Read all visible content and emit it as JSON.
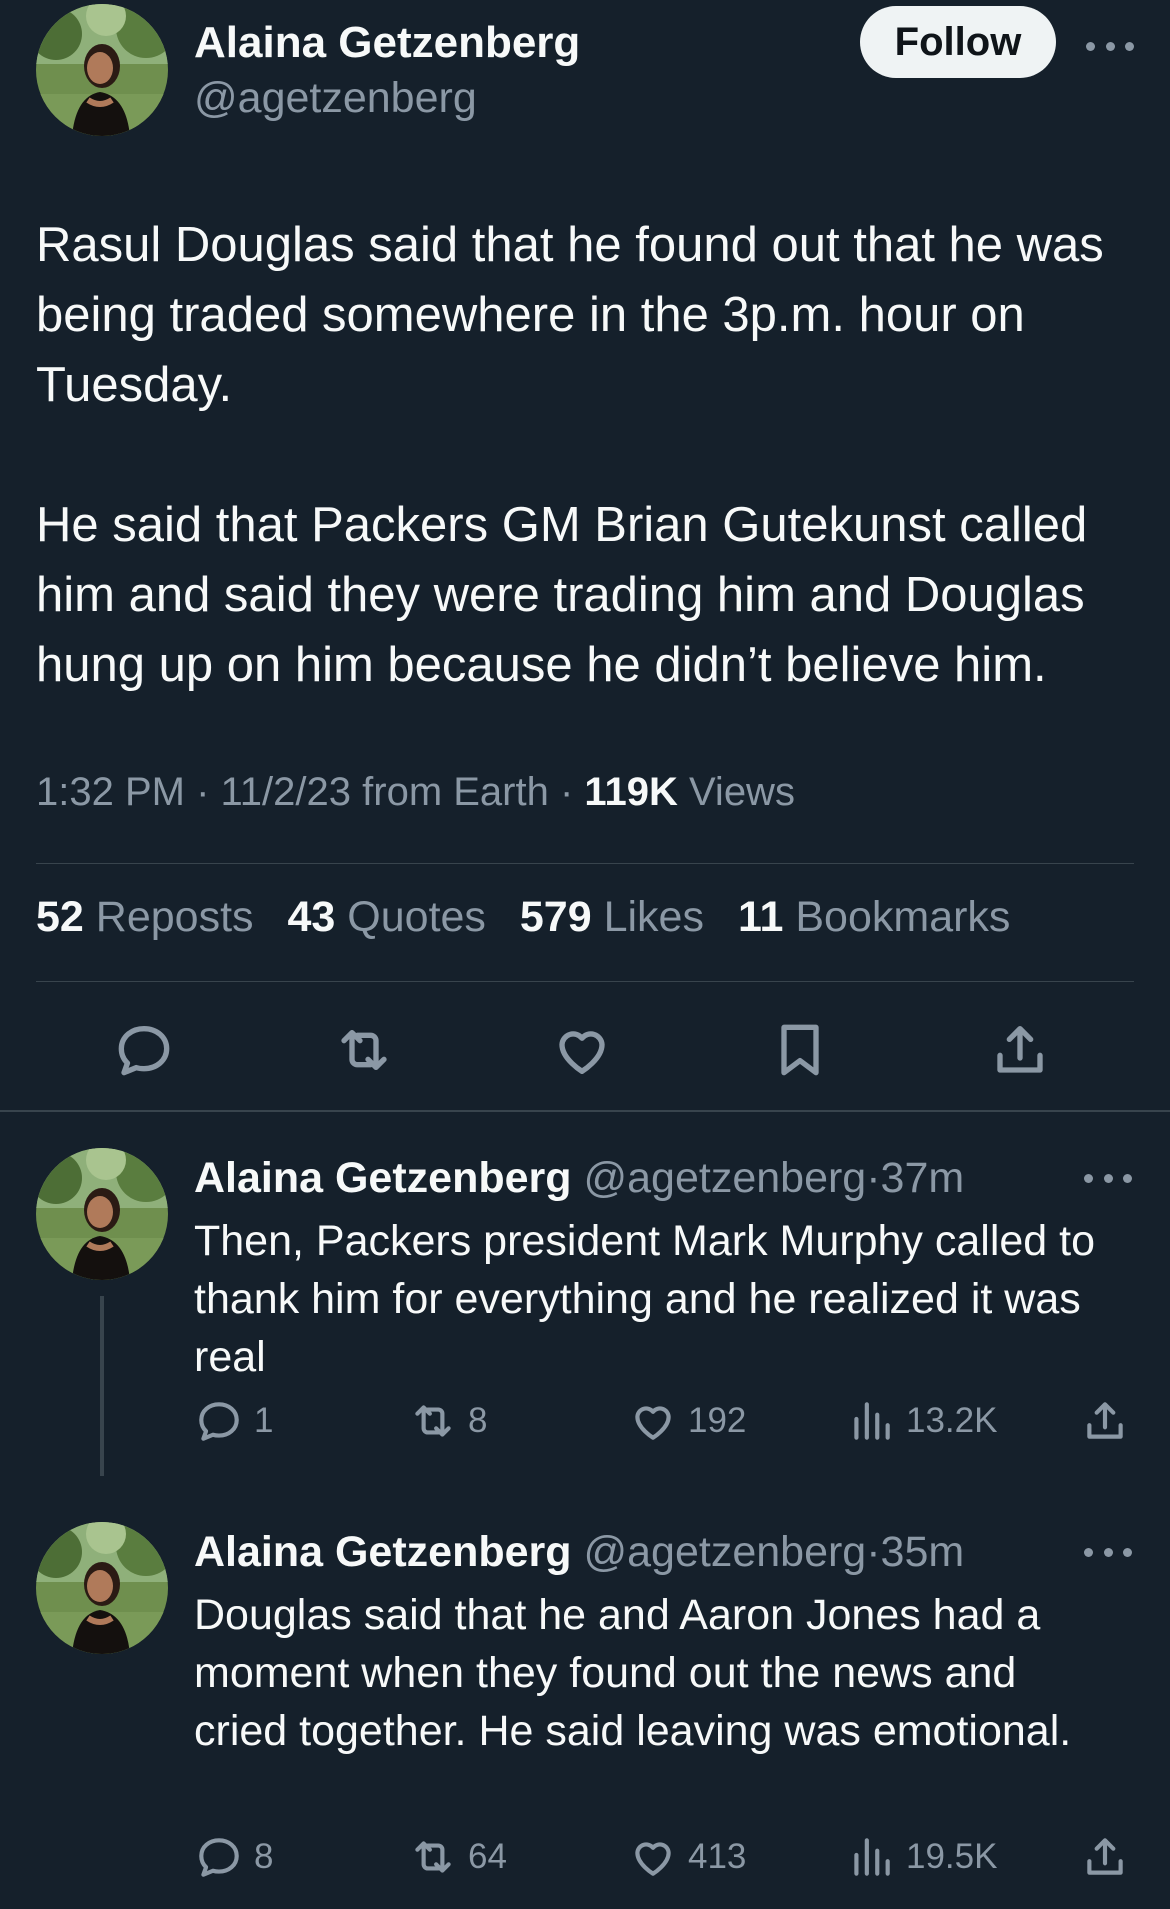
{
  "main_tweet": {
    "author_name": "Alaina Getzenberg",
    "author_handle": "@agetzenberg",
    "follow_label": "Follow",
    "text": "Rasul Douglas said that he found out that he was being traded somewhere in the 3p.m. hour on Tuesday.\n\nHe said that Packers GM Brian Gutekunst called him and said they were trading him and Douglas hung up on him because he didn’t believe him.",
    "time": "1:32 PM",
    "date_source": "11/2/23 from Earth",
    "views_count": "119K",
    "views_label": "Views",
    "stats": [
      {
        "count": "52",
        "label": "Reposts"
      },
      {
        "count": "43",
        "label": "Quotes"
      },
      {
        "count": "579",
        "label": "Likes"
      },
      {
        "count": "11",
        "label": "Bookmarks"
      }
    ],
    "actions": [
      "reply-icon",
      "repost-icon",
      "like-icon",
      "bookmark-icon",
      "share-icon"
    ]
  },
  "replies": [
    {
      "author_name": "Alaina Getzenberg",
      "author_handle": "@agetzenberg",
      "age": "37m",
      "text": "Then, Packers president Mark Murphy called to thank him for everything and he realized it was real",
      "reply_count": "1",
      "repost_count": "8",
      "like_count": "192",
      "view_count": "13.2K"
    },
    {
      "author_name": "Alaina Getzenberg",
      "author_handle": "@agetzenberg",
      "age": "35m",
      "text": "Douglas said that he and Aaron Jones had a moment when they found out the news and cried together. He said leaving was emotional.",
      "reply_count": "8",
      "repost_count": "64",
      "like_count": "413",
      "view_count": "19.5K"
    }
  ],
  "colors": {
    "background": "#15202b",
    "text": "#f7f9f9",
    "muted": "#8b98a5",
    "divider": "#38444d",
    "follow_button_bg": "#eff3f4"
  }
}
